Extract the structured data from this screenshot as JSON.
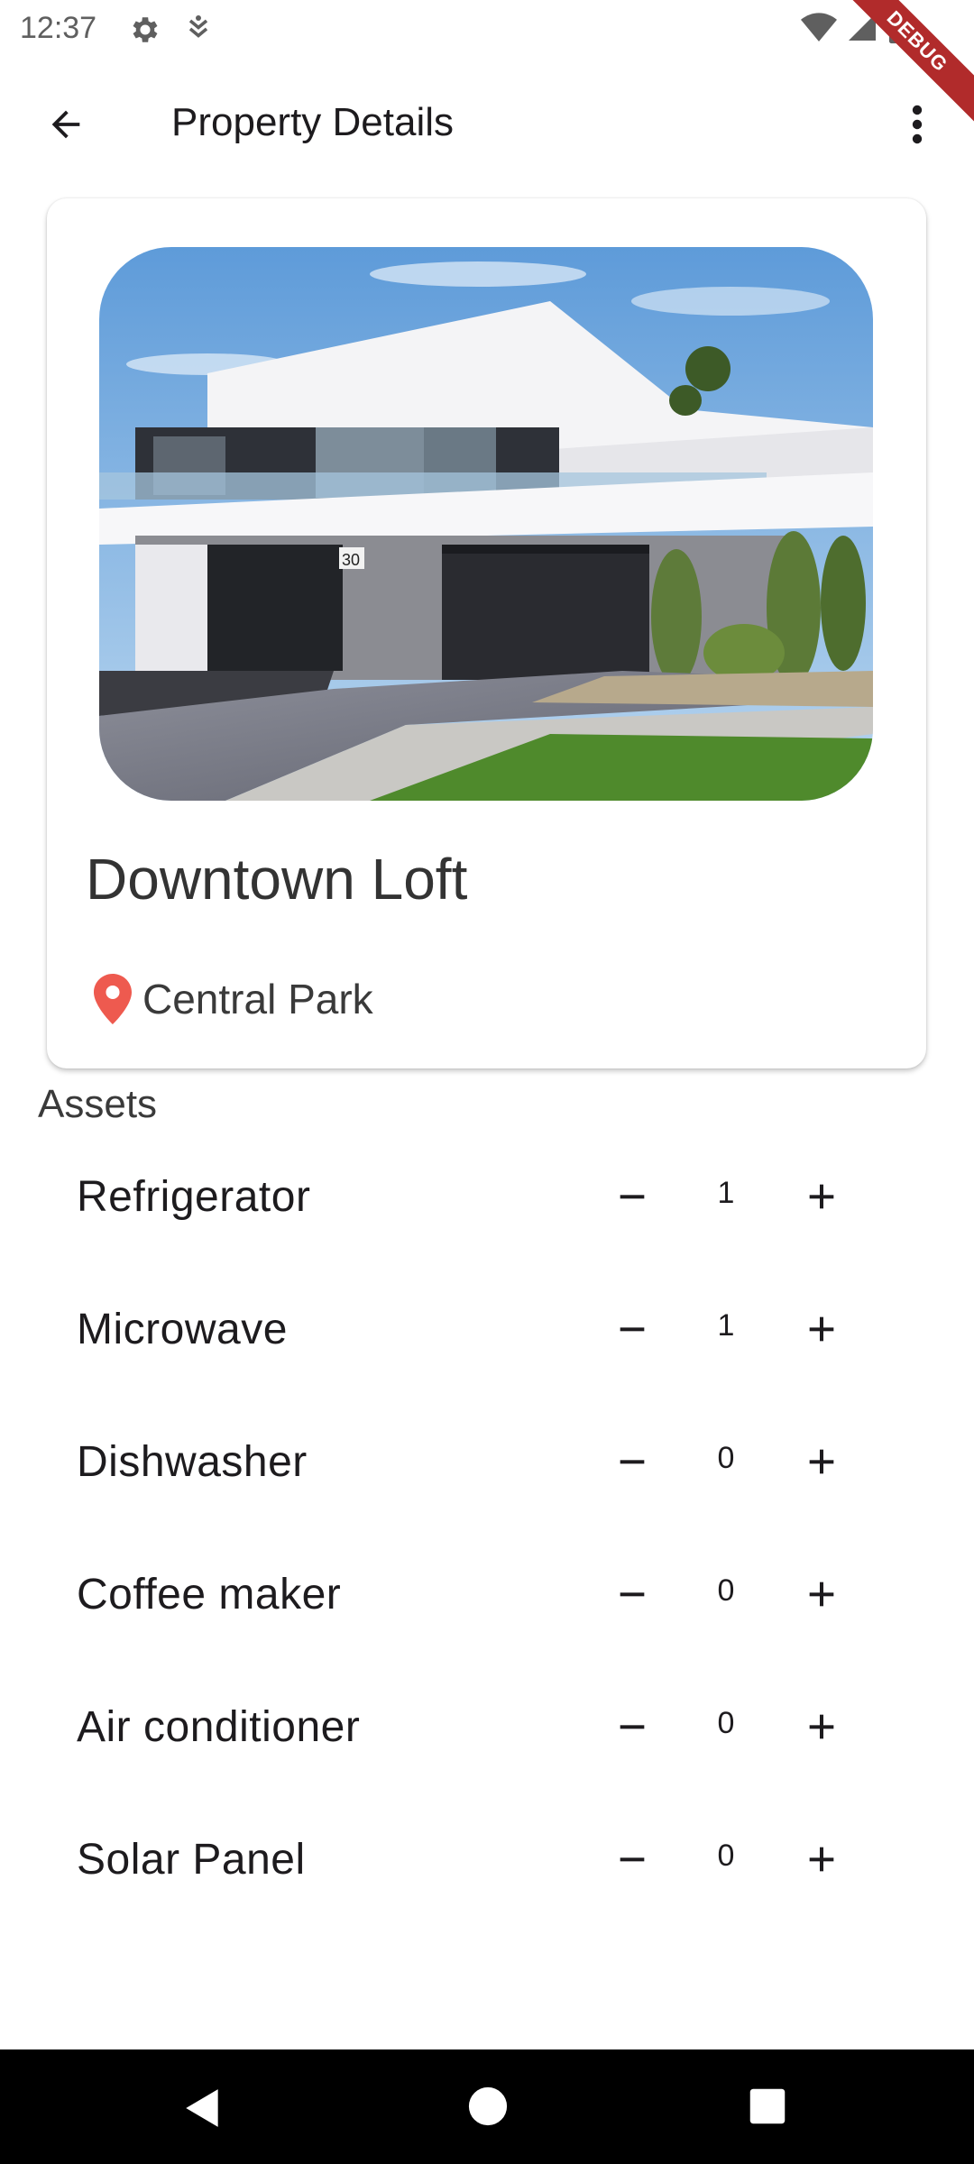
{
  "status_bar": {
    "time": "12:37",
    "debug_label": "DEBUG"
  },
  "app_bar": {
    "title": "Property Details",
    "back_icon": "arrow-back-icon",
    "more_icon": "more-vert-icon"
  },
  "property": {
    "name": "Downtown Loft",
    "location": "Central Park",
    "pin_color": "#ee5a4f"
  },
  "assets": {
    "heading": "Assets",
    "items": [
      {
        "name": "Refrigerator",
        "count": "1"
      },
      {
        "name": "Microwave",
        "count": "1"
      },
      {
        "name": "Dishwasher",
        "count": "0"
      },
      {
        "name": "Coffee maker",
        "count": "0"
      },
      {
        "name": "Air conditioner",
        "count": "0"
      },
      {
        "name": "Solar Panel",
        "count": "0"
      }
    ]
  }
}
